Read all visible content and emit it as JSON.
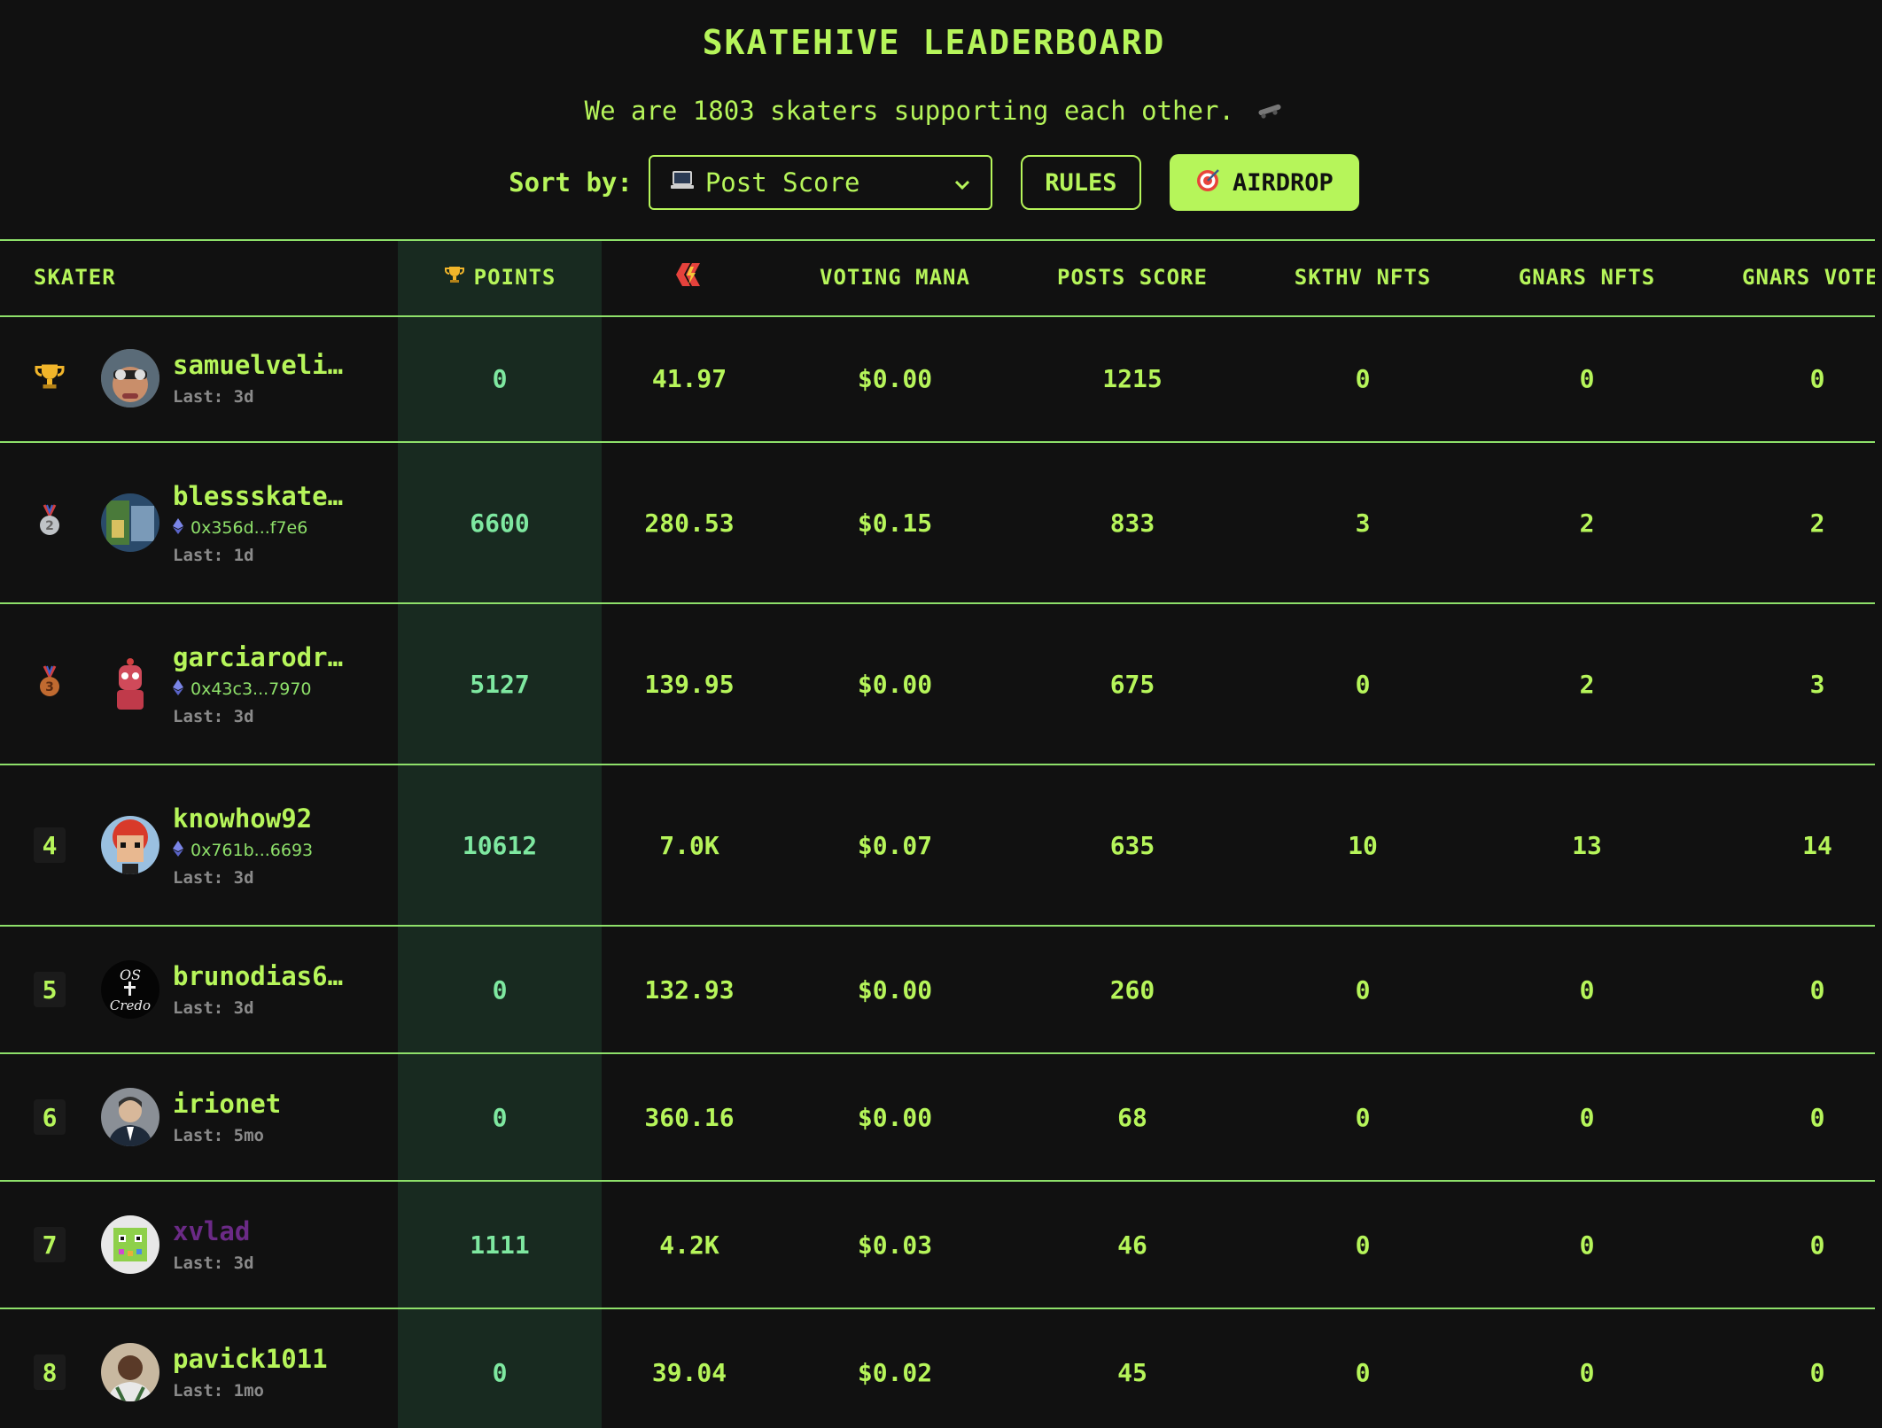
{
  "header": {
    "title": "SKATEHIVE LEADERBOARD",
    "subtitle": "We are 1803 skaters supporting each other.",
    "sort_label": "Sort by:",
    "sort_value": "Post Score",
    "rules_label": "RULES",
    "airdrop_label": "AIRDROP"
  },
  "columns": {
    "skater": "SKATER",
    "points": "POINTS",
    "voting_mana": "VOTING MANA",
    "posts_score": "POSTS SCORE",
    "skthv_nfts": "SKTHV NFTS",
    "gnars_nfts": "GNARS NFTS",
    "gnars_votes": "GNARS VOTE"
  },
  "colors": {
    "accent": "#b6f55a",
    "background": "#111111",
    "points_bg": "#182a20",
    "divider": "#8ee06a"
  },
  "rows": [
    {
      "rank": "",
      "medal": "trophy",
      "name": "samuelveli…",
      "wallet": "",
      "last": "Last: 3d",
      "points": "0",
      "power": "41.97",
      "mana": "$0.00",
      "posts": "1215",
      "skthv": "0",
      "gnars": "0",
      "votes": "0"
    },
    {
      "rank": "",
      "medal": "silver",
      "name": "blessskate…",
      "wallet": "0x356d...f7e6",
      "last": "Last: 1d",
      "points": "6600",
      "power": "280.53",
      "mana": "$0.15",
      "posts": "833",
      "skthv": "3",
      "gnars": "2",
      "votes": "2"
    },
    {
      "rank": "",
      "medal": "bronze",
      "name": "garciarodr…",
      "wallet": "0x43c3...7970",
      "last": "Last: 3d",
      "points": "5127",
      "power": "139.95",
      "mana": "$0.00",
      "posts": "675",
      "skthv": "0",
      "gnars": "2",
      "votes": "3"
    },
    {
      "rank": "4",
      "medal": "",
      "name": "knowhow92",
      "wallet": "0x761b...6693",
      "last": "Last: 3d",
      "points": "10612",
      "power": "7.0K",
      "mana": "$0.07",
      "posts": "635",
      "skthv": "10",
      "gnars": "13",
      "votes": "14"
    },
    {
      "rank": "5",
      "medal": "",
      "name": "brunodias6…",
      "wallet": "",
      "last": "Last: 3d",
      "points": "0",
      "power": "132.93",
      "mana": "$0.00",
      "posts": "260",
      "skthv": "0",
      "gnars": "0",
      "votes": "0"
    },
    {
      "rank": "6",
      "medal": "",
      "name": "irionet",
      "wallet": "",
      "last": "Last: 5mo",
      "points": "0",
      "power": "360.16",
      "mana": "$0.00",
      "posts": "68",
      "skthv": "0",
      "gnars": "0",
      "votes": "0"
    },
    {
      "rank": "7",
      "medal": "",
      "name": "xvlad",
      "wallet": "",
      "last": "Last: 3d",
      "points": "1111",
      "power": "4.2K",
      "mana": "$0.03",
      "posts": "46",
      "skthv": "0",
      "gnars": "0",
      "votes": "0"
    },
    {
      "rank": "8",
      "medal": "",
      "name": "pavick1011",
      "wallet": "",
      "last": "Last: 1mo",
      "points": "0",
      "power": "39.04",
      "mana": "$0.02",
      "posts": "45",
      "skthv": "0",
      "gnars": "0",
      "votes": "0"
    }
  ]
}
